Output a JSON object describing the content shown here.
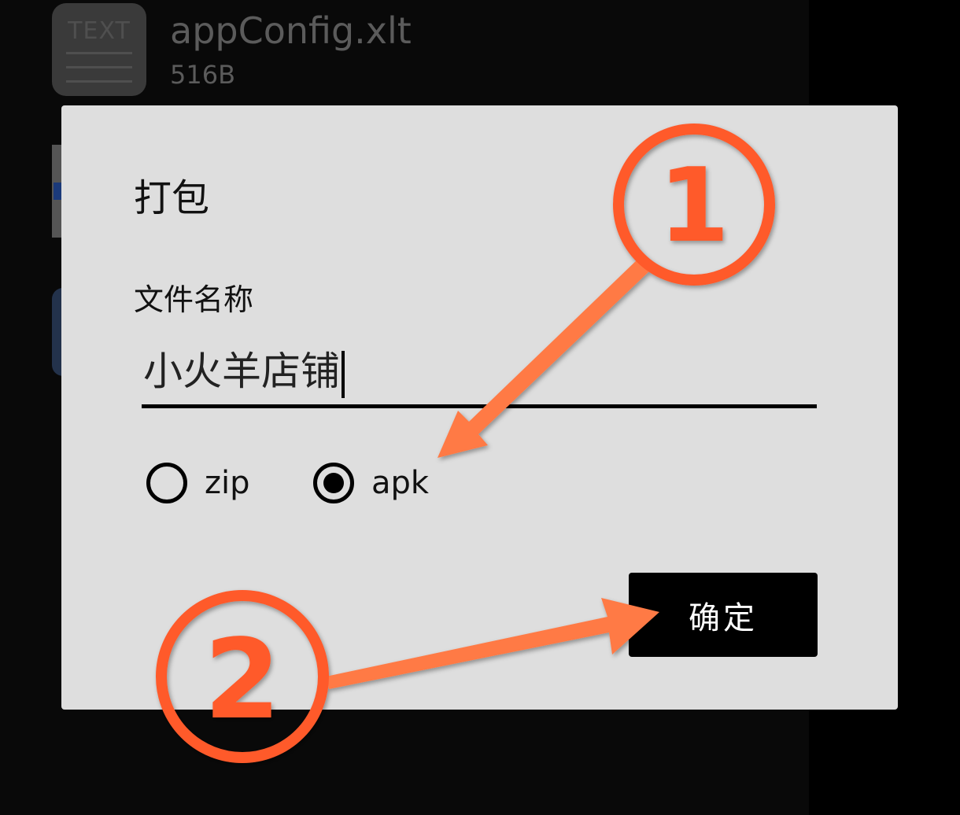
{
  "background_file": {
    "icon_text": "TEXT",
    "name": "appConfig.xlt",
    "size": "516B"
  },
  "dialog": {
    "title": "打包",
    "field_label": "文件名称",
    "field_value": "小火羊店铺",
    "options": [
      {
        "label": "zip",
        "selected": false
      },
      {
        "label": "apk",
        "selected": true
      }
    ],
    "confirm_label": "确定"
  },
  "annotations": {
    "step1": "1",
    "step2": "2",
    "color": "#ff5a2c"
  }
}
